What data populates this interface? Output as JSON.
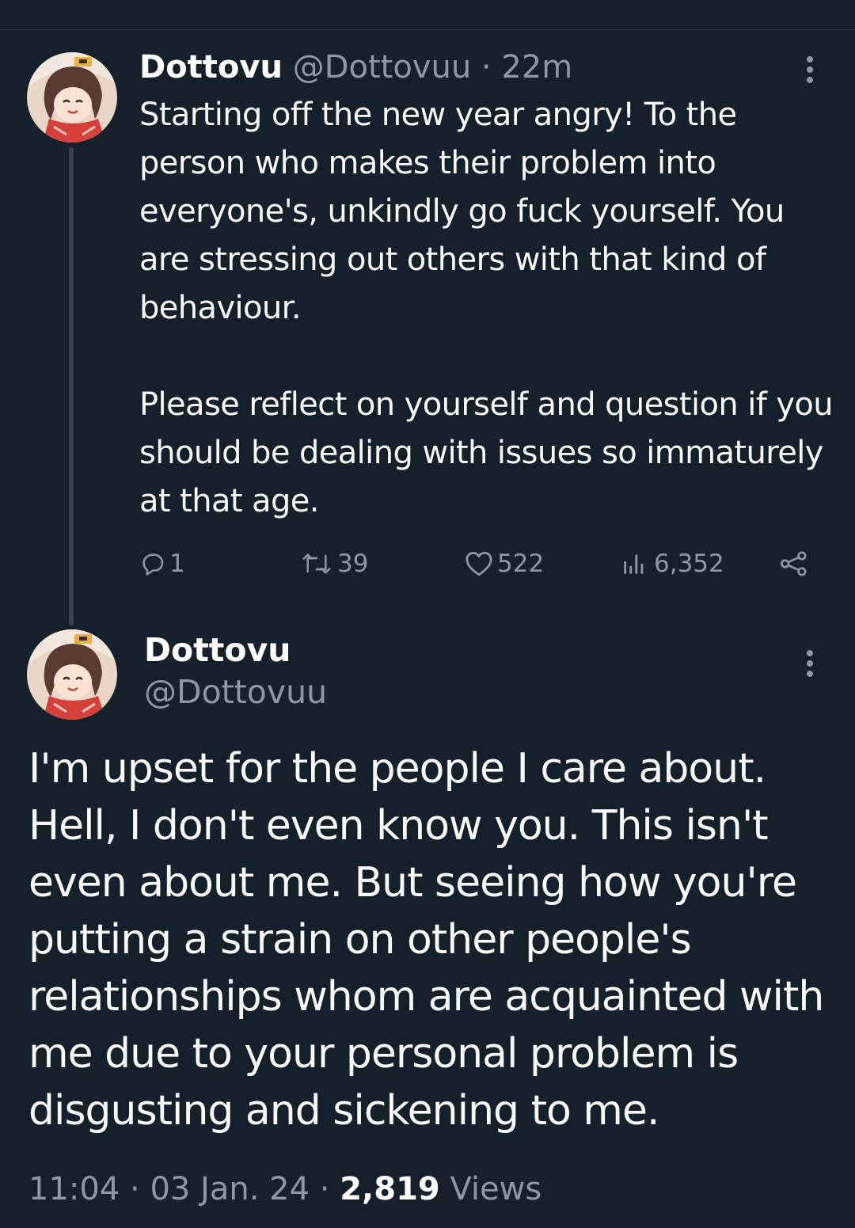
{
  "thread": {
    "first_tweet": {
      "display_name": "Dottovu",
      "handle": "@Dottovuu",
      "separator": "·",
      "time": "22m",
      "paragraphs": [
        "Starting off the new year angry! To the person who makes their problem into everyone's, unkindly go fuck yourself. You are stressing out others with that kind of behaviour.",
        "Please reflect on yourself and question if you should be dealing with issues so immaturely at that age."
      ],
      "actions": {
        "replies": "1",
        "retweets": "39",
        "likes": "522",
        "views": "6,352"
      }
    },
    "second_tweet": {
      "display_name": "Dottovu",
      "handle": "@Dottovuu",
      "text": "I'm upset for the people I care about. Hell, I don't even know you. This isn't even about me. But seeing how you're putting a strain on other people's relationships whom are acquainted with me due to your personal problem is disgusting and sickening to me.",
      "time": "11:04",
      "sep1": " · ",
      "date": "03 Jan. 24",
      "sep2": " · ",
      "views_count": "2,819",
      "views_label": " Views"
    }
  },
  "icons": {
    "reply": "reply-icon",
    "retweet": "retweet-icon",
    "like": "heart-icon",
    "views": "views-chart-icon",
    "share": "share-icon",
    "more": "more-vertical-icon"
  },
  "colors": {
    "background": "#15202b",
    "secondary_text": "#8b98a5",
    "primary_text": "#f7f9f9",
    "divider": "#38444d"
  }
}
